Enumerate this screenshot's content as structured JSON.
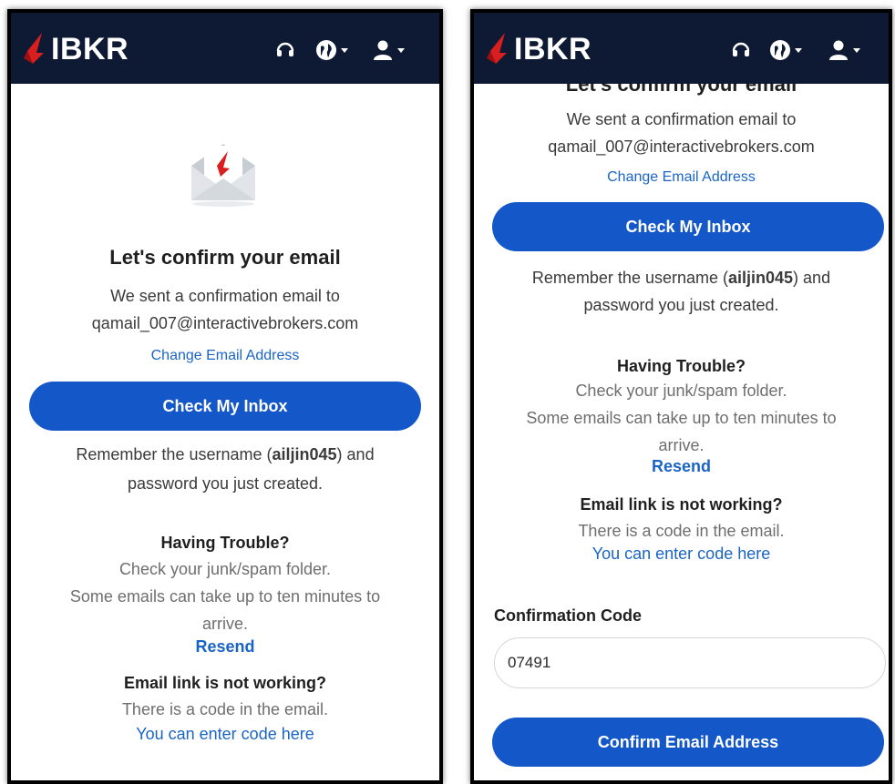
{
  "brand": {
    "name": "IBKR"
  },
  "header": {
    "icons": [
      "headset-icon",
      "globe-icon",
      "user-icon"
    ]
  },
  "confirm": {
    "title": "Let's confirm your email",
    "sent_line": "We sent a confirmation email to",
    "email": "qamail_007@interactivebrokers.com",
    "change_email": "Change Email Address",
    "check_inbox": "Check My Inbox",
    "remember_prefix": "Remember the username (",
    "username": "ailjin045",
    "remember_suffix": ") and",
    "remember_line2": "password you just created.",
    "trouble_heading": "Having Trouble?",
    "trouble_line1": "Check your junk/spam folder.",
    "trouble_line2": "Some emails can take up to ten minutes to",
    "trouble_line3": "arrive.",
    "resend": "Resend",
    "link_heading": "Email link is not working?",
    "link_line": "There is a code in the email.",
    "enter_code": "You can enter code here",
    "code_label": "Confirmation Code",
    "code_value": "07491",
    "confirm_button": "Confirm Email Address",
    "partial_title": "Let's confirm your email"
  },
  "colors": {
    "navbar": "#0e1a33",
    "primary": "#1357c9",
    "link": "#1a64c6",
    "brand_red": "#d81e1e"
  }
}
